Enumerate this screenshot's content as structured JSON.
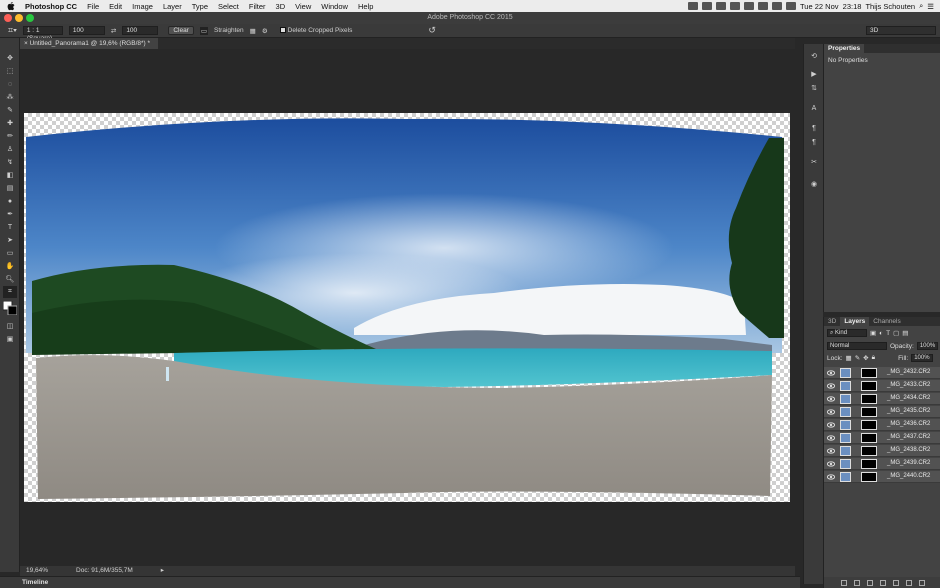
{
  "menubar": {
    "items": [
      "Photoshop CC",
      "File",
      "Edit",
      "Image",
      "Layer",
      "Type",
      "Select",
      "Filter",
      "3D",
      "View",
      "Window",
      "Help"
    ],
    "clock": "Tue 22 Nov  23:18",
    "user": "Thijs Schouten"
  },
  "window_title": "Adobe Photoshop CC 2015",
  "options": {
    "ratio": "1 : 1 (Square)",
    "width": "100",
    "height": "100",
    "clear": "Clear",
    "straighten": "Straighten",
    "delete_cropped": "Delete Cropped Pixels",
    "workspace": "3D"
  },
  "document": {
    "tab_title": "Untitled_Panorama1 @ 19,6% (RGB/8*) *"
  },
  "status": {
    "zoom": "19,64%",
    "doc": "Doc: 91,6M/355,7M"
  },
  "timeline": "Timeline",
  "properties": {
    "tab": "Properties",
    "empty": "No Properties"
  },
  "layers": {
    "tabs": [
      "3D",
      "Layers",
      "Channels"
    ],
    "kind": "Kind",
    "blend": "Normal",
    "opacity_label": "Opacity:",
    "opacity": "100%",
    "lock_label": "Lock:",
    "fill_label": "Fill:",
    "fill": "100%",
    "list": [
      "_MG_2432.CR2",
      "_MG_2433.CR2",
      "_MG_2434.CR2",
      "_MG_2435.CR2",
      "_MG_2436.CR2",
      "_MG_2437.CR2",
      "_MG_2438.CR2",
      "_MG_2439.CR2",
      "_MG_2440.CR2"
    ]
  },
  "colors": {
    "sky_top": "#1f4f9c",
    "sky_bottom": "#8fb4dc",
    "lake": "#3fb6c7",
    "beach": "#9a968f",
    "forest": "#1e4a22"
  }
}
